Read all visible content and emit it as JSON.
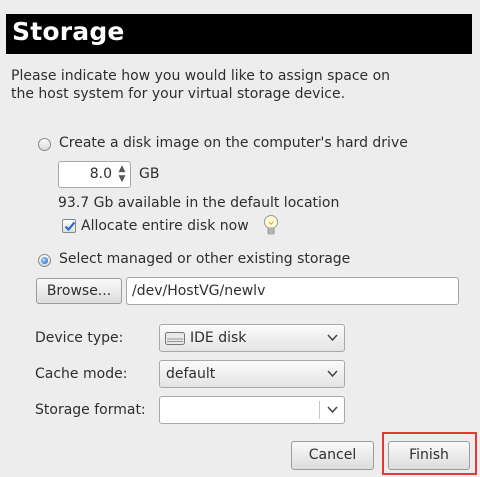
{
  "header": {
    "title": "Storage"
  },
  "description": "Please indicate how you would like to assign space on the host system for your virtual storage device.",
  "disk_image": {
    "radio_label": "Create a disk image on the computer's hard drive",
    "size_value": "8.0",
    "size_unit": "GB",
    "available_text": "93.7 Gb available in the default location",
    "allocate_label": "Allocate entire disk now",
    "allocate_checked": true
  },
  "managed": {
    "radio_label": "Select managed or other existing storage",
    "browse_label": "Browse...",
    "path_value": "/dev/HostVG/newlv"
  },
  "device_type": {
    "label": "Device type:",
    "value": "IDE disk"
  },
  "cache_mode": {
    "label": "Cache mode:",
    "value": "default"
  },
  "storage_format": {
    "label": "Storage format:",
    "value": ""
  },
  "buttons": {
    "cancel": "Cancel",
    "finish": "Finish"
  },
  "colors": {
    "highlight": "#e53935",
    "header_bg": "#000000"
  }
}
